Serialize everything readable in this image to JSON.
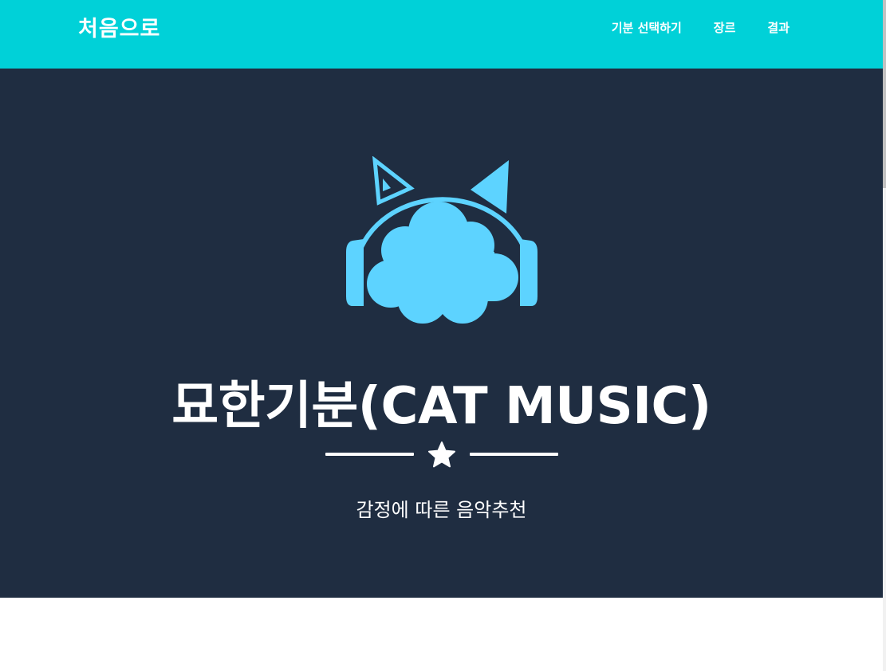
{
  "navbar": {
    "brand": "처음으로",
    "links": [
      {
        "label": "기분 선택하기"
      },
      {
        "label": "장르"
      },
      {
        "label": "결과"
      }
    ],
    "background_color": "#00d1d8"
  },
  "hero": {
    "logo_icon": "cat-headphones-cloud-icon",
    "title": "묘한기분(CAT MUSIC)",
    "divider_icon": "star-icon",
    "subtitle": "감정에 따른 음악추천",
    "background_color": "#1f2d41",
    "logo_color": "#5dd3ff"
  }
}
